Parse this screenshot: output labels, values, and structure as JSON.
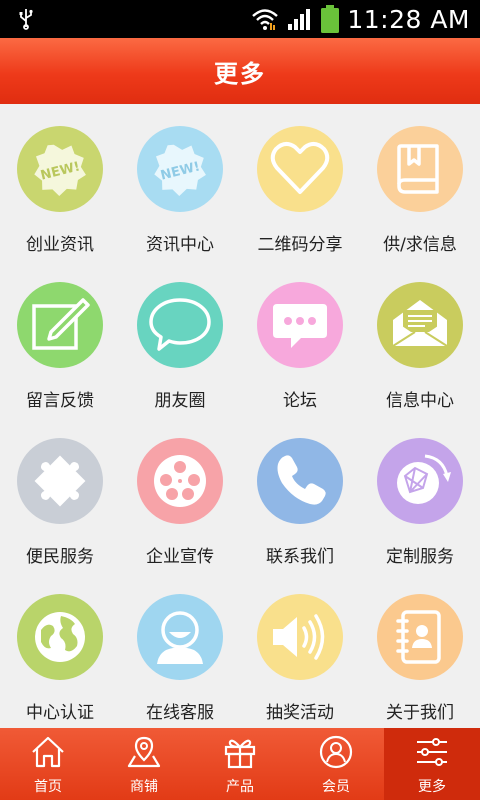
{
  "status": {
    "time": "11:28 AM"
  },
  "header": {
    "title": "更多"
  },
  "grid": [
    {
      "label": "创业资讯",
      "icon": "new-badge-icon",
      "color": "#c9d66f"
    },
    {
      "label": "资讯中心",
      "icon": "new-badge-icon",
      "color": "#a8dcf2"
    },
    {
      "label": "二维码分享",
      "icon": "heart-icon",
      "color": "#f9e08c"
    },
    {
      "label": "供/求信息",
      "icon": "book-icon",
      "color": "#fbd09a"
    },
    {
      "label": "留言反馈",
      "icon": "edit-note-icon",
      "color": "#8ed86e"
    },
    {
      "label": "朋友圈",
      "icon": "speech-bubble-icon",
      "color": "#68d4c0"
    },
    {
      "label": "论坛",
      "icon": "chat-dots-icon",
      "color": "#f7a8dc"
    },
    {
      "label": "信息中心",
      "icon": "envelope-icon",
      "color": "#c9cc5e"
    },
    {
      "label": "便民服务",
      "icon": "puzzle-icon",
      "color": "#c9ced6"
    },
    {
      "label": "企业宣传",
      "icon": "film-reel-icon",
      "color": "#f7a3a8"
    },
    {
      "label": "联系我们",
      "icon": "phone-icon",
      "color": "#90b7e6"
    },
    {
      "label": "定制服务",
      "icon": "network-globe-icon",
      "color": "#c4a4ea"
    },
    {
      "label": "中心认证",
      "icon": "globe-icon",
      "color": "#b9d46a"
    },
    {
      "label": "在线客服",
      "icon": "user-icon",
      "color": "#9fd6f0"
    },
    {
      "label": "抽奖活动",
      "icon": "speaker-icon",
      "color": "#f9e08c"
    },
    {
      "label": "关于我们",
      "icon": "contacts-book-icon",
      "color": "#fbc98e"
    }
  ],
  "tabs": [
    {
      "label": "首页",
      "icon": "home-icon"
    },
    {
      "label": "商铺",
      "icon": "map-pin-icon"
    },
    {
      "label": "产品",
      "icon": "gift-icon"
    },
    {
      "label": "会员",
      "icon": "member-icon"
    },
    {
      "label": "更多",
      "icon": "sliders-icon",
      "active": true
    }
  ]
}
